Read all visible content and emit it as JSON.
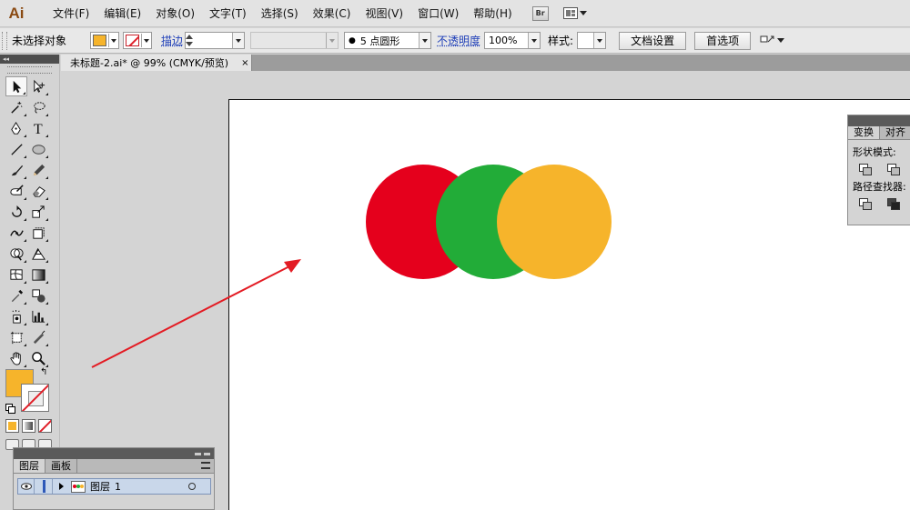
{
  "app": {
    "logo": "Ai"
  },
  "menu": [
    "文件(F)",
    "编辑(E)",
    "对象(O)",
    "文字(T)",
    "选择(S)",
    "效果(C)",
    "视图(V)",
    "窗口(W)",
    "帮助(H)"
  ],
  "menu_extras": {
    "bridge_label": "Br"
  },
  "control_bar": {
    "selection_status": "未选择对象",
    "fill_color": "#f6b42b",
    "stroke_label": "描边",
    "brush_value": "5 点圆形",
    "opacity_label": "不透明度",
    "opacity_value": "100%",
    "style_label": "样式",
    "doc_setup_button": "文档设置",
    "preferences_button": "首选项"
  },
  "document_tab": {
    "title": "未标题-2.ai* @ 99% (CMYK/预览)",
    "close": "×"
  },
  "tools": [
    [
      "selection-tool",
      "direct-selection-tool"
    ],
    [
      "magic-wand-tool",
      "lasso-tool"
    ],
    [
      "pen-tool",
      "type-tool"
    ],
    [
      "line-segment-tool",
      "ellipse-tool"
    ],
    [
      "paintbrush-tool",
      "pencil-tool"
    ],
    [
      "blob-brush-tool",
      "eraser-tool"
    ],
    [
      "rotate-tool",
      "scale-tool"
    ],
    [
      "width-tool",
      "free-transform-tool"
    ],
    [
      "shape-builder-tool",
      "perspective-grid-tool"
    ],
    [
      "mesh-tool",
      "gradient-tool"
    ],
    [
      "eyedropper-tool",
      "blend-tool"
    ],
    [
      "symbol-sprayer-tool",
      "column-graph-tool"
    ],
    [
      "artboard-tool",
      "slice-tool"
    ],
    [
      "hand-tool",
      "zoom-tool"
    ]
  ],
  "tools_panel": {
    "collapse_label": "◂◂"
  },
  "colors": {
    "red_circle": "#e5001c",
    "green_circle": "#22ac38",
    "yellow_circle": "#f6b42b",
    "annotation_arrow": "#e31b23"
  },
  "artwork": {
    "circles": [
      "red",
      "green",
      "yellow"
    ]
  },
  "layers_panel": {
    "tabs": [
      "图层",
      "画板"
    ],
    "layer_name": "图层",
    "layer_number": "1"
  },
  "right_panel": {
    "tabs": [
      "变换",
      "对齐"
    ],
    "shape_modes_label": "形状模式:",
    "pathfinder_label": "路径查找器:"
  }
}
